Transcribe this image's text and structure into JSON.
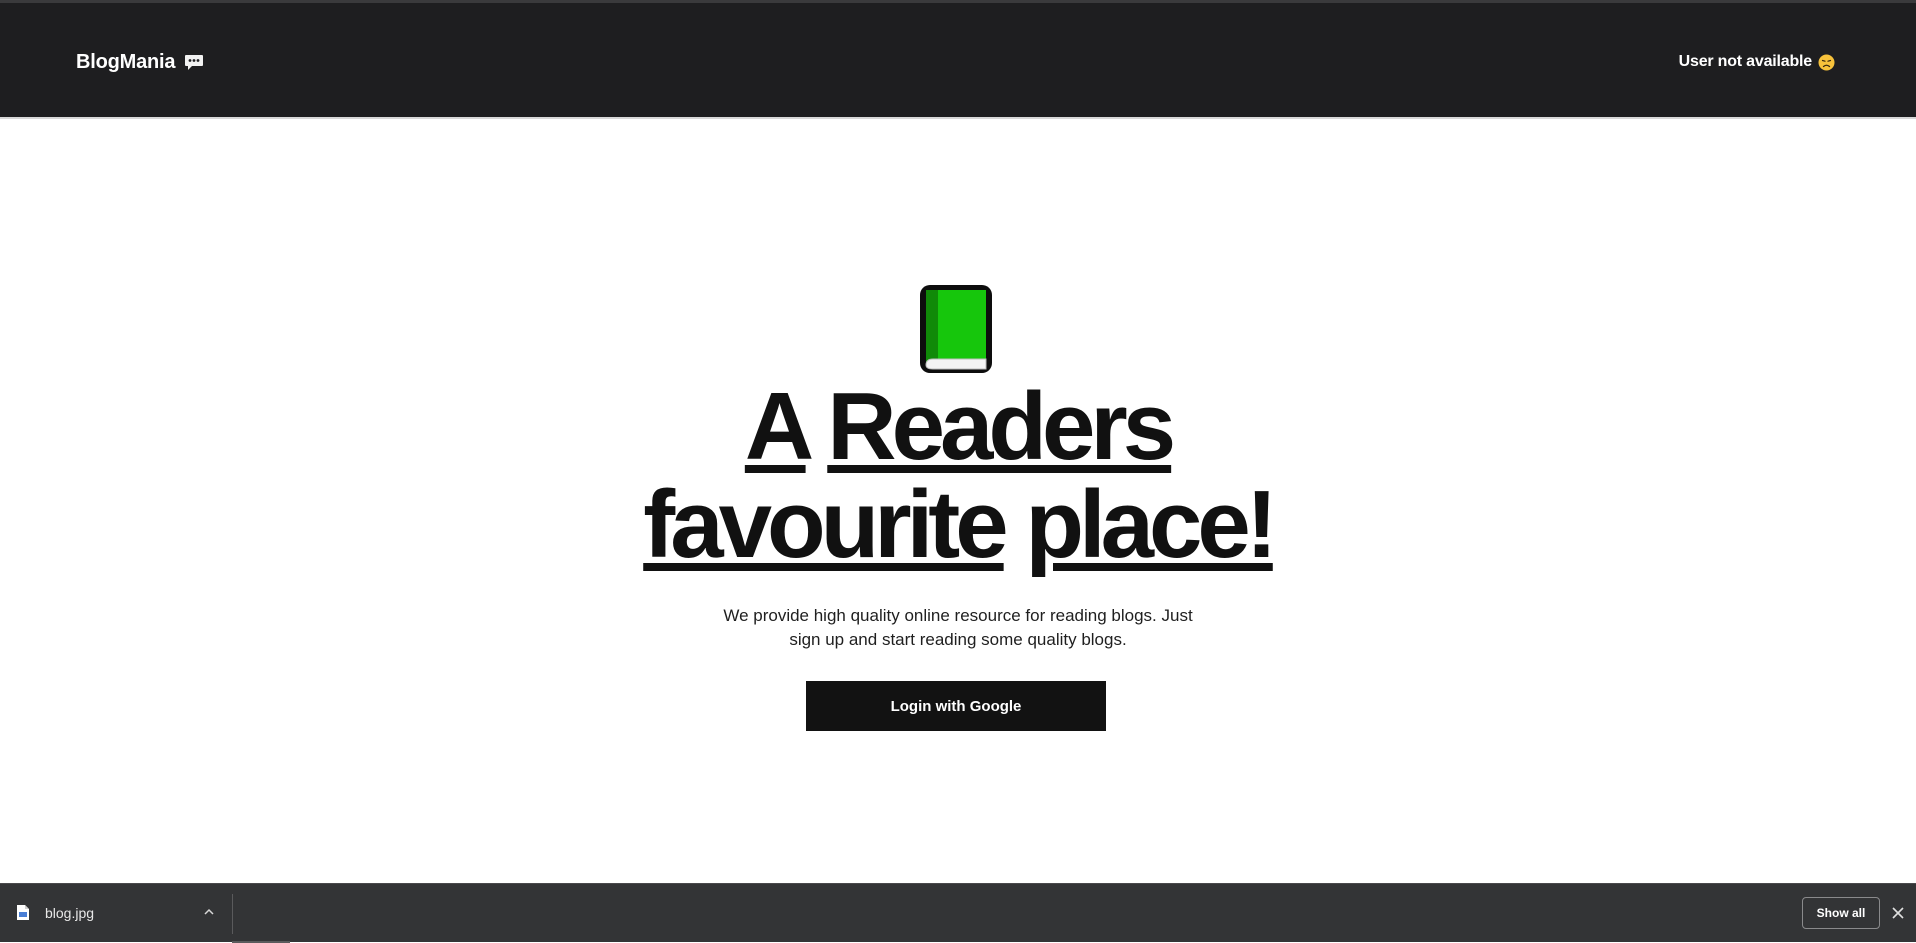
{
  "navbar": {
    "brand_label": "BlogMania",
    "brand_icon": "speech-bubble-icon",
    "user_status": "User not available",
    "user_status_icon": "disappointed-face-icon"
  },
  "hero": {
    "icon": "green-book-icon",
    "headline_line1": [
      "A",
      "Readers"
    ],
    "headline_line2": [
      "favourite",
      "place!"
    ],
    "subtitle": "We provide high quality online resource for reading blogs. Just sign up and start reading some quality blogs.",
    "login_button": "Login with Google"
  },
  "download_bar": {
    "file_name": "blog.jpg",
    "file_icon": "image-file-icon",
    "show_all": "Show all"
  },
  "colors": {
    "navbar_bg": "#1e1e20",
    "book_green": "#16c60c",
    "button_bg": "#121212",
    "download_bar_bg": "#333436"
  }
}
